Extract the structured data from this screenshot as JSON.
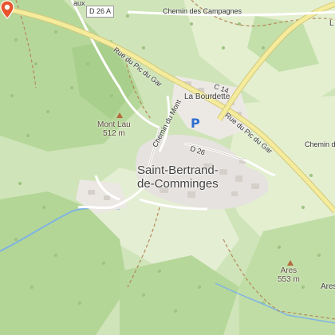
{
  "map": {
    "roads": {
      "d26a": "D 26 A",
      "d26": "D 26",
      "c14": "C 14",
      "rue_pic_du_gar_upper": "Rue du Pic du Gar",
      "rue_pic_du_gar_lower": "Rue du Pic du Gar",
      "chemin_des_campagnes": "Chemin des Campagnes",
      "chemin_du_mont": "Chemin du Mont",
      "chemin_de_right": "Chemin de",
      "edge_top_left": "aux"
    },
    "places": {
      "la_bourdette": "La Bourdette",
      "town_line1": "Saint-Bertrand-",
      "town_line2": "de-Comminges",
      "ares_edge": "Ares",
      "edge_top_right": "L"
    },
    "peaks": [
      {
        "name": "Mont Lau",
        "elevation": "512 m"
      },
      {
        "name": "Ares",
        "elevation": "553 m"
      }
    ],
    "poi": {
      "parking_symbol": "P",
      "marker_icon": "location-pin-icon"
    },
    "colors": {
      "forest": "#b6d79a",
      "meadow": "#e3efcf",
      "urban": "#e6e2df",
      "road_major": "#f4ec9c",
      "water": "#7fb3e3",
      "marker": "#e8542d"
    }
  }
}
